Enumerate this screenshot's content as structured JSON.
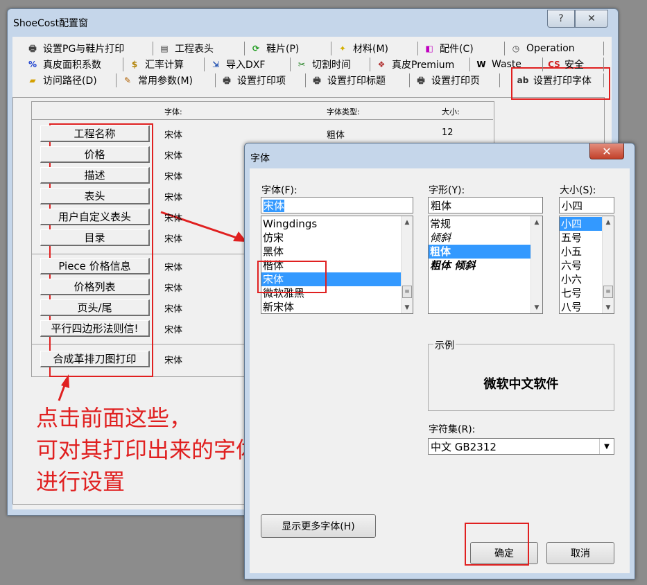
{
  "main_window": {
    "title": "ShoeCost配置窗",
    "help_button": "?",
    "close_button": "✕",
    "tabs_row1": [
      {
        "label": "设置PG与鞋片打印",
        "icon": "printer-settings-icon"
      },
      {
        "label": "工程表头",
        "icon": "table-icon"
      },
      {
        "label": "鞋片(P)",
        "icon": "refresh-icon"
      },
      {
        "label": "材料(M)",
        "icon": "material-icon"
      },
      {
        "label": "配件(C)",
        "icon": "accessory-icon"
      },
      {
        "label": "Operation",
        "icon": "clock-icon"
      }
    ],
    "tabs_row2": [
      {
        "label": "真皮面积系数",
        "icon": "percent-icon"
      },
      {
        "label": "汇率计算",
        "icon": "exchange-icon"
      },
      {
        "label": "导入DXF",
        "icon": "import-icon"
      },
      {
        "label": "切割时间",
        "icon": "cut-time-icon"
      },
      {
        "label": "真皮Premium",
        "icon": "leather-icon"
      },
      {
        "label": "Waste",
        "icon": "waste-icon"
      },
      {
        "label": "安全",
        "icon": "security-icon"
      }
    ],
    "tabs_row3": [
      {
        "label": "访问路径(D)",
        "icon": "folder-icon"
      },
      {
        "label": "常用参数(M)",
        "icon": "params-icon"
      },
      {
        "label": "设置打印项",
        "icon": "printer-icon"
      },
      {
        "label": "设置打印标题",
        "icon": "printer-icon"
      },
      {
        "label": "设置打印页",
        "icon": "printer-icon"
      },
      {
        "label": "设置打印字体",
        "icon": "font-icon"
      }
    ],
    "grid_headers": {
      "font": "字体:",
      "font_type": "字体类型:",
      "size": "大小:"
    },
    "rows": [
      {
        "label": "工程名称",
        "font": "宋体",
        "type": "粗体",
        "size": "12"
      },
      {
        "label": "价格",
        "font": "宋体"
      },
      {
        "label": "描述",
        "font": "宋体"
      },
      {
        "label": "表头",
        "font": "宋体"
      },
      {
        "label": "用户自定义表头",
        "font": "宋体"
      },
      {
        "label": "目录",
        "font": "宋体"
      },
      {
        "label": "Piece 价格信息",
        "font": "宋体"
      },
      {
        "label": "价格列表",
        "font": "宋体"
      },
      {
        "label": "页头/尾",
        "font": "宋体"
      },
      {
        "label": "平行四边形法则信!",
        "font": "宋体"
      },
      {
        "label": "合成革排刀图打印",
        "font": "宋体"
      }
    ],
    "annotation": [
      "点击前面这些，",
      "可对其打印出来的字体",
      "进行设置"
    ]
  },
  "font_dialog": {
    "title": "字体",
    "close_button": "✕",
    "font_label": "字体(F):",
    "font_value": "宋体",
    "font_list": [
      "Wingdings",
      "仿宋",
      "黑体",
      "楷体",
      "宋体",
      "微软雅黑",
      "新宋体"
    ],
    "font_selected": "宋体",
    "style_label": "字形(Y):",
    "style_value": "粗体",
    "style_list": [
      "常规",
      "倾斜",
      "粗体",
      "粗体 倾斜"
    ],
    "style_selected": "粗体",
    "size_label": "大小(S):",
    "size_value": "小四",
    "size_list": [
      "小四",
      "五号",
      "小五",
      "六号",
      "小六",
      "七号",
      "八号"
    ],
    "size_selected": "小四",
    "sample_label": "示例",
    "sample_text": "微软中文软件",
    "charset_label": "字符集(R):",
    "charset_value": "中文 GB2312",
    "more_fonts_button": "显示更多字体(H)",
    "ok_button": "确定",
    "cancel_button": "取消"
  },
  "colors": {
    "highlight": "#e02020",
    "selection": "#3399ff"
  }
}
